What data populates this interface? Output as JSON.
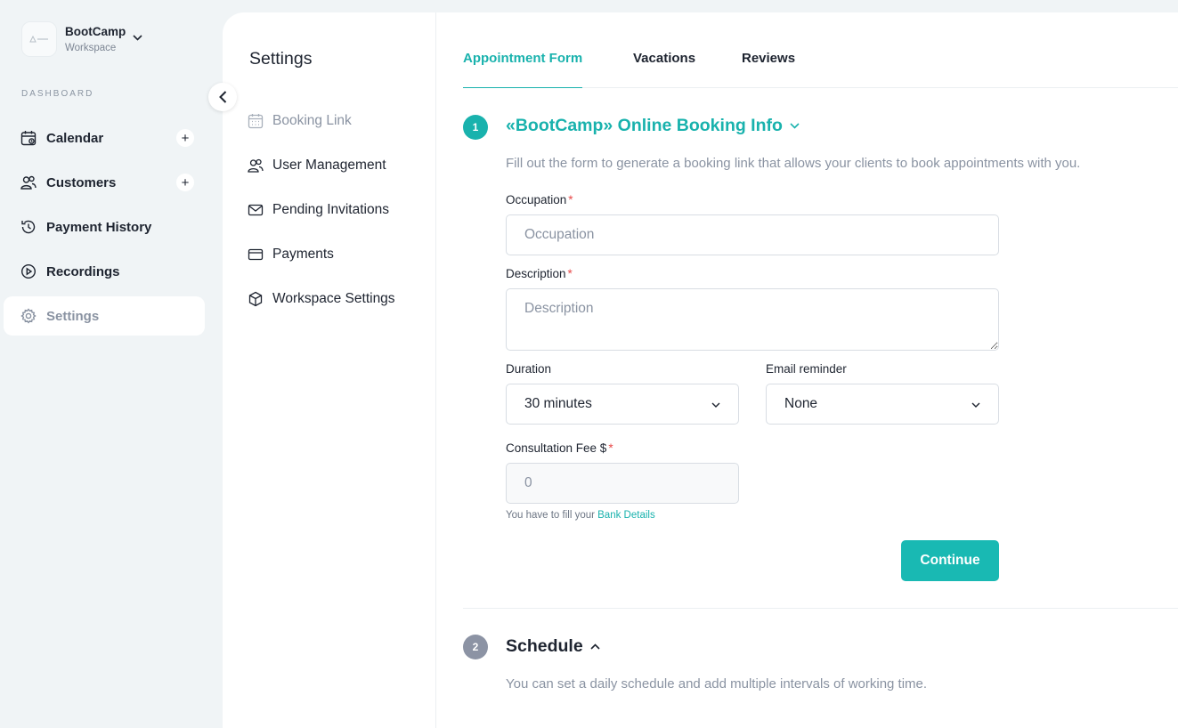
{
  "workspace": {
    "name": "BootCamp",
    "subtitle": "Workspace"
  },
  "sidebar": {
    "section_label": "DASHBOARD",
    "items": [
      {
        "label": "Calendar",
        "icon": "calendar-icon",
        "has_add": true
      },
      {
        "label": "Customers",
        "icon": "users-icon",
        "has_add": true
      },
      {
        "label": "Payment History",
        "icon": "history-icon",
        "has_add": false
      },
      {
        "label": "Recordings",
        "icon": "play-circle-icon",
        "has_add": false
      },
      {
        "label": "Settings",
        "icon": "gear-icon",
        "has_add": false,
        "active": true
      }
    ],
    "add_symbol": "+"
  },
  "settings": {
    "title": "Settings",
    "items": [
      {
        "label": "Booking Link",
        "icon": "calendar-icon",
        "active": true
      },
      {
        "label": "User Management",
        "icon": "users-icon"
      },
      {
        "label": "Pending Invitations",
        "icon": "envelope-icon"
      },
      {
        "label": "Payments",
        "icon": "credit-card-icon"
      },
      {
        "label": "Workspace Settings",
        "icon": "cube-icon"
      }
    ]
  },
  "tabs": [
    {
      "label": "Appointment Form",
      "active": true
    },
    {
      "label": "Vacations"
    },
    {
      "label": "Reviews"
    }
  ],
  "section1": {
    "step": "1",
    "title": "«BootCamp» Online Booking Info",
    "description": "Fill out the form to generate a booking link that allows your clients to book appointments with you.",
    "occupation": {
      "label": "Occupation",
      "required_mark": "*",
      "placeholder": "Occupation",
      "value": ""
    },
    "description_field": {
      "label": "Description",
      "required_mark": "*",
      "placeholder": "Description",
      "value": ""
    },
    "duration": {
      "label": "Duration",
      "value": "30 minutes"
    },
    "email_reminder": {
      "label": "Email reminder",
      "value": "None"
    },
    "fee": {
      "label": "Consultation Fee $",
      "required_mark": "*",
      "placeholder": "0"
    },
    "hint_text": "You have to fill your ",
    "hint_link": "Bank Details",
    "continue_label": "Continue"
  },
  "section2": {
    "step": "2",
    "title": "Schedule",
    "description": "You can set a daily schedule and add multiple intervals of working time."
  },
  "colors": {
    "accent": "#19b2ad",
    "background": "#f0f4f6",
    "text": "#1e2430",
    "muted": "#8a93a2",
    "required": "#e84a4a",
    "step_inactive": "#8c93a4"
  }
}
